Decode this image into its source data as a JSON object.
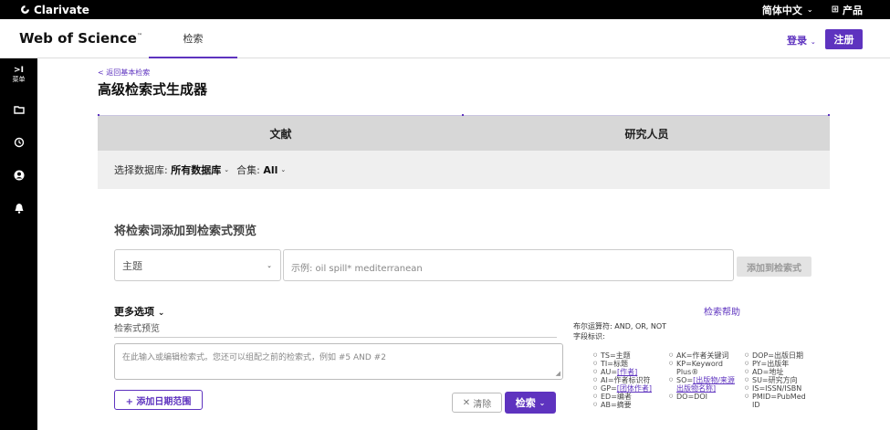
{
  "topbar": {
    "brand": "Clarivate",
    "language": "简体中文",
    "products": "产品"
  },
  "header": {
    "logo": "Web of Science",
    "tm": "™",
    "tab_search": "检索",
    "login": "登录",
    "register": "注册"
  },
  "sidebar": {
    "menu_label": "菜单"
  },
  "page": {
    "back_link": "< 返回基本检索",
    "title": "高级检索式生成器"
  },
  "tabs": [
    "文献",
    "研究人员"
  ],
  "database": {
    "label": "选择数据库:",
    "value": "所有数据库",
    "collection_label": "合集:",
    "collection_value": "All"
  },
  "builder": {
    "section_title": "将检索词添加到检索式预览",
    "field_value": "主题",
    "query_placeholder": "示例: oil spill* mediterranean",
    "add_button": "添加到检索式",
    "more_options": "更多选项",
    "help_link": "检索帮助",
    "preview_label": "检索式预览",
    "preview_placeholder": "在此输入或编辑检索式。您还可以组配之前的检索式，例如 #5 AND #2",
    "date_range_button": "+ 添加日期范围",
    "clear_button": "清除",
    "search_button": "检索"
  },
  "reference": {
    "boolean_ops": "布尔运算符: AND, OR, NOT",
    "field_tags_label": "字段标识:",
    "col1": [
      {
        "pre": "TS=",
        "text": "主题",
        "link": false
      },
      {
        "pre": "TI=",
        "text": "标题",
        "link": false
      },
      {
        "pre": "AU=",
        "text": "[作者]",
        "link": true
      },
      {
        "pre": "AI=",
        "text": "作者标识符",
        "link": false
      },
      {
        "pre": "GP=",
        "text": "[团体作者]",
        "link": true
      },
      {
        "pre": "ED=",
        "text": "编者",
        "link": false
      },
      {
        "pre": "AB=",
        "text": "摘要",
        "link": false
      }
    ],
    "col2": [
      {
        "pre": "AK=",
        "text": "作者关键词",
        "link": false
      },
      {
        "pre": "KP=",
        "text": "Keyword Plus®",
        "link": false
      },
      {
        "pre": "SO=",
        "text": "[出版物/来源出版物名称]",
        "link": true
      },
      {
        "pre": "DO=",
        "text": "DOI",
        "link": false
      }
    ],
    "col3": [
      {
        "pre": "DOP=",
        "text": "出版日期",
        "link": false
      },
      {
        "pre": "PY=",
        "text": "出版年",
        "link": false
      },
      {
        "pre": "AD=",
        "text": "地址",
        "link": false
      },
      {
        "pre": "SU=",
        "text": "研究方向",
        "link": false
      },
      {
        "pre": "IS=",
        "text": "ISSN/ISBN",
        "link": false
      },
      {
        "pre": "PMID=",
        "text": "PubMed ID",
        "link": false
      }
    ]
  },
  "colors": {
    "accent": "#5e33bf",
    "topbar": "#000000",
    "tabs_bg": "#d7d7d7"
  }
}
